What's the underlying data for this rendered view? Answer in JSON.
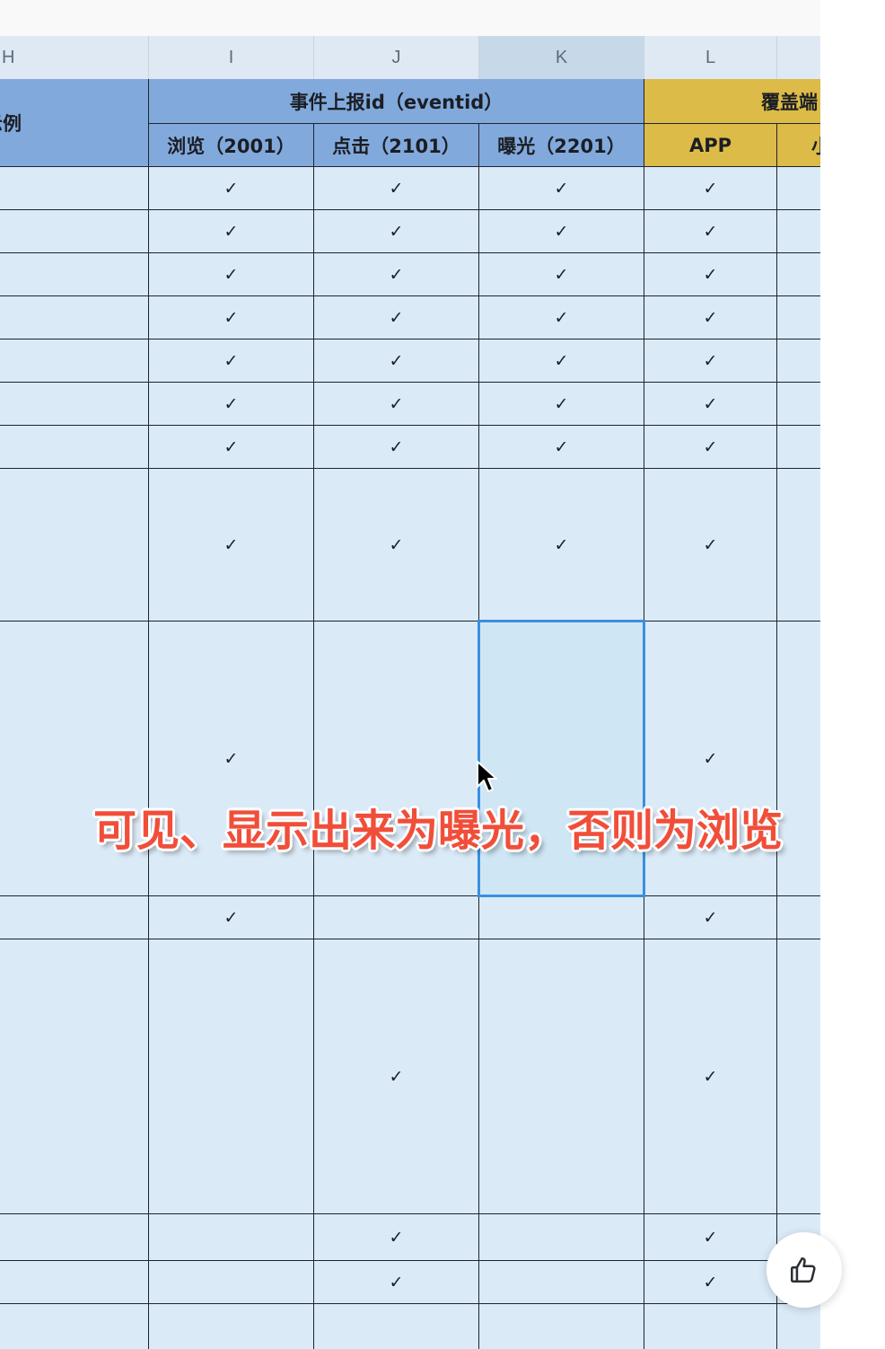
{
  "column_letters": [
    "H",
    "I",
    "J",
    "K",
    "L"
  ],
  "active_column": "K",
  "header": {
    "h_group_label": "示例",
    "event_group_label": "事件上报id（eventid）",
    "coverage_group_label": "覆盖端",
    "sub_headers": [
      "浏览（2001）",
      "点击（2101）",
      "曝光（2201）",
      "APP",
      "小"
    ]
  },
  "check_mark": "✓",
  "rows": [
    {
      "I": "✓",
      "J": "✓",
      "K": "✓",
      "L": "✓"
    },
    {
      "I": "✓",
      "J": "✓",
      "K": "✓",
      "L": "✓"
    },
    {
      "I": "✓",
      "J": "✓",
      "K": "✓",
      "L": "✓"
    },
    {
      "I": "✓",
      "J": "✓",
      "K": "✓",
      "L": "✓"
    },
    {
      "I": "✓",
      "J": "✓",
      "K": "✓",
      "L": "✓"
    },
    {
      "I": "✓",
      "J": "✓",
      "K": "✓",
      "L": "✓"
    },
    {
      "I": "✓",
      "J": "✓",
      "K": "✓",
      "L": "✓"
    },
    {
      "I": "✓",
      "J": "✓",
      "K": "✓",
      "L": "✓"
    },
    {
      "I": "✓",
      "J": "",
      "K": "",
      "L": "✓"
    },
    {
      "I": "✓",
      "J": "",
      "K": "",
      "L": "✓"
    },
    {
      "I": "",
      "J": "✓",
      "K": "",
      "L": "✓"
    },
    {
      "I": "",
      "J": "✓",
      "K": "",
      "L": "✓"
    },
    {
      "I": "",
      "J": "✓",
      "K": "",
      "L": "✓"
    },
    {
      "I": "",
      "J": "",
      "K": "",
      "L": ""
    }
  ],
  "selected_cell": {
    "column": "K",
    "row_index": 8
  },
  "caption": "可见、显示出来为曝光，否则为浏览",
  "colors": {
    "event_header": "#82a9dc",
    "coverage_header": "#ddbb48",
    "cell_background": "#dbeaf7",
    "selection_border": "#3a8fe0",
    "caption": "#f14e3a"
  },
  "icons": {
    "like": "thumbs-up-icon",
    "cursor": "mouse-pointer-icon"
  }
}
